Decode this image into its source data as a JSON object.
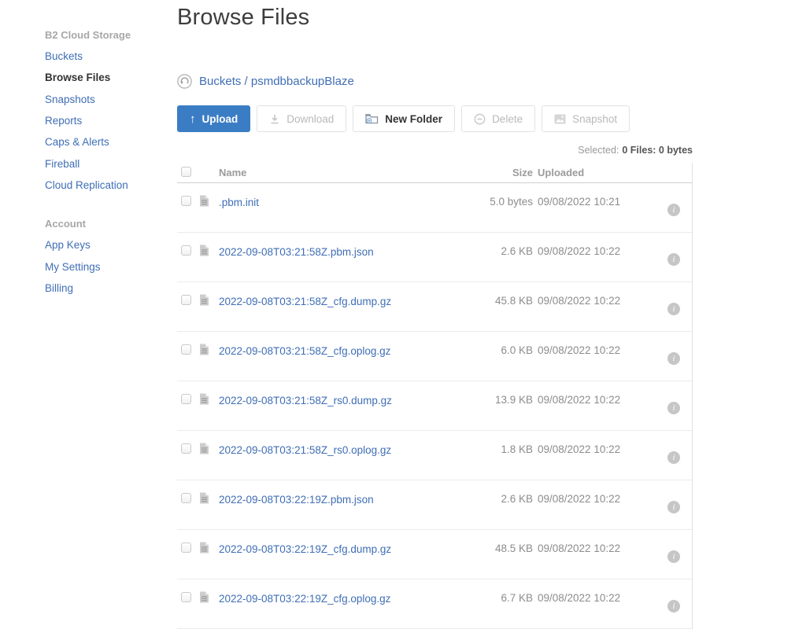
{
  "colors": {
    "accent_blue": "#3b7dc4",
    "link_blue": "#3f6eb5",
    "active_text": "#333333",
    "muted_gray": "#9b9b9b",
    "disabled_gray": "#b9b9b9"
  },
  "icons": {
    "back_icon": "rotate-ccw-circle",
    "upload_icon": "↑",
    "download_icon": "arrow-down-to-line",
    "new_folder_icon": "folder-plus",
    "delete_icon": "minus-circle",
    "snapshot_icon": "image",
    "file_icon": "document",
    "info_icon": "i"
  },
  "sidebar": {
    "sections": [
      {
        "header": "B2 Cloud Storage",
        "items": [
          {
            "id": "buckets",
            "label": "Buckets",
            "active": false
          },
          {
            "id": "browse-files",
            "label": "Browse Files",
            "active": true
          },
          {
            "id": "snapshots",
            "label": "Snapshots",
            "active": false
          },
          {
            "id": "reports",
            "label": "Reports",
            "active": false
          },
          {
            "id": "caps-alerts",
            "label": "Caps & Alerts",
            "active": false
          },
          {
            "id": "fireball",
            "label": "Fireball",
            "active": false
          },
          {
            "id": "cloud-replication",
            "label": "Cloud Replication",
            "active": false
          }
        ]
      },
      {
        "header": "Account",
        "items": [
          {
            "id": "app-keys",
            "label": "App Keys",
            "active": false
          },
          {
            "id": "my-settings",
            "label": "My Settings",
            "active": false
          },
          {
            "id": "billing",
            "label": "Billing",
            "active": false
          }
        ]
      }
    ]
  },
  "page_title": "Browse Files",
  "breadcrumb": {
    "root": "Buckets",
    "separator": " / ",
    "current": "psmdbbackupBlaze"
  },
  "toolbar": {
    "upload_label": "Upload",
    "download_label": "Download",
    "new_folder_label": "New Folder",
    "delete_label": "Delete",
    "snapshot_label": "Snapshot"
  },
  "selection": {
    "label": "Selected:",
    "value": "0 Files: 0 bytes"
  },
  "table": {
    "columns": {
      "name": "Name",
      "size": "Size",
      "uploaded": "Uploaded"
    },
    "rows": [
      {
        "name": ".pbm.init",
        "size": "5.0 bytes",
        "uploaded": "09/08/2022 10:21"
      },
      {
        "name": "2022-09-08T03:21:58Z.pbm.json",
        "size": "2.6 KB",
        "uploaded": "09/08/2022 10:22"
      },
      {
        "name": "2022-09-08T03:21:58Z_cfg.dump.gz",
        "size": "45.8 KB",
        "uploaded": "09/08/2022 10:22"
      },
      {
        "name": "2022-09-08T03:21:58Z_cfg.oplog.gz",
        "size": "6.0 KB",
        "uploaded": "09/08/2022 10:22"
      },
      {
        "name": "2022-09-08T03:21:58Z_rs0.dump.gz",
        "size": "13.9 KB",
        "uploaded": "09/08/2022 10:22"
      },
      {
        "name": "2022-09-08T03:21:58Z_rs0.oplog.gz",
        "size": "1.8 KB",
        "uploaded": "09/08/2022 10:22"
      },
      {
        "name": "2022-09-08T03:22:19Z.pbm.json",
        "size": "2.6 KB",
        "uploaded": "09/08/2022 10:22"
      },
      {
        "name": "2022-09-08T03:22:19Z_cfg.dump.gz",
        "size": "48.5 KB",
        "uploaded": "09/08/2022 10:22"
      },
      {
        "name": "2022-09-08T03:22:19Z_cfg.oplog.gz",
        "size": "6.7 KB",
        "uploaded": "09/08/2022 10:22"
      }
    ]
  }
}
